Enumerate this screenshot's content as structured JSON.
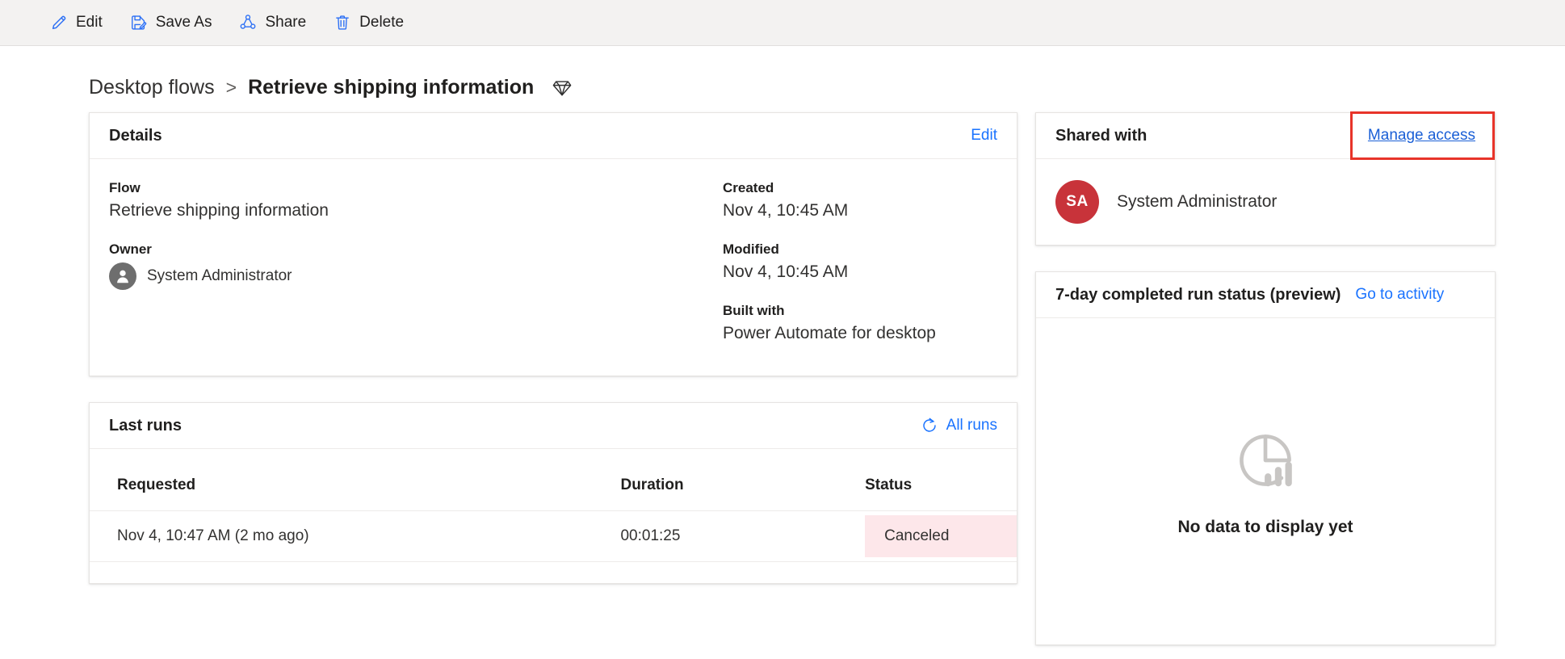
{
  "commandbar": {
    "buttons": [
      {
        "label": "Edit",
        "icon": "pencil-icon"
      },
      {
        "label": "Save As",
        "icon": "save-as-icon"
      },
      {
        "label": "Share",
        "icon": "share-icon"
      },
      {
        "label": "Delete",
        "icon": "trash-icon"
      }
    ]
  },
  "breadcrumb": {
    "parent": "Desktop flows",
    "separator": ">",
    "current": "Retrieve shipping information",
    "badge_icon": "gem-icon"
  },
  "details": {
    "title": "Details",
    "edit_label": "Edit",
    "fields": {
      "flow_label": "Flow",
      "flow_value": "Retrieve shipping information",
      "owner_label": "Owner",
      "owner_value": "System Administrator",
      "created_label": "Created",
      "created_value": "Nov 4, 10:45 AM",
      "modified_label": "Modified",
      "modified_value": "Nov 4, 10:45 AM",
      "built_with_label": "Built with",
      "built_with_value": "Power Automate for desktop"
    }
  },
  "last_runs": {
    "title": "Last runs",
    "all_runs_label": "All runs",
    "refresh_icon": "refresh-icon",
    "columns": [
      "Requested",
      "Duration",
      "Status"
    ],
    "rows": [
      {
        "requested": "Nov 4, 10:47 AM (2 mo ago)",
        "duration": "00:01:25",
        "status": "Canceled"
      }
    ]
  },
  "shared_with": {
    "title": "Shared with",
    "manage_access_label": "Manage access",
    "highlighted": true,
    "people": [
      {
        "initials": "SA",
        "name": "System Administrator",
        "avatar_color": "#c8333a"
      }
    ]
  },
  "run_status": {
    "title": "7-day completed run status (preview)",
    "go_to_activity_label": "Go to activity",
    "empty_state_icon": "chart-empty-icon",
    "empty_state_text": "No data to display yet"
  },
  "colors": {
    "accent_blue": "#1a73ff",
    "link_blue": "#0f6cbd",
    "highlight_red": "#e8342a",
    "status_canceled_bg": "#fde7ea",
    "avatar_red": "#c8333a",
    "commandbar_bg": "#f3f2f1"
  }
}
